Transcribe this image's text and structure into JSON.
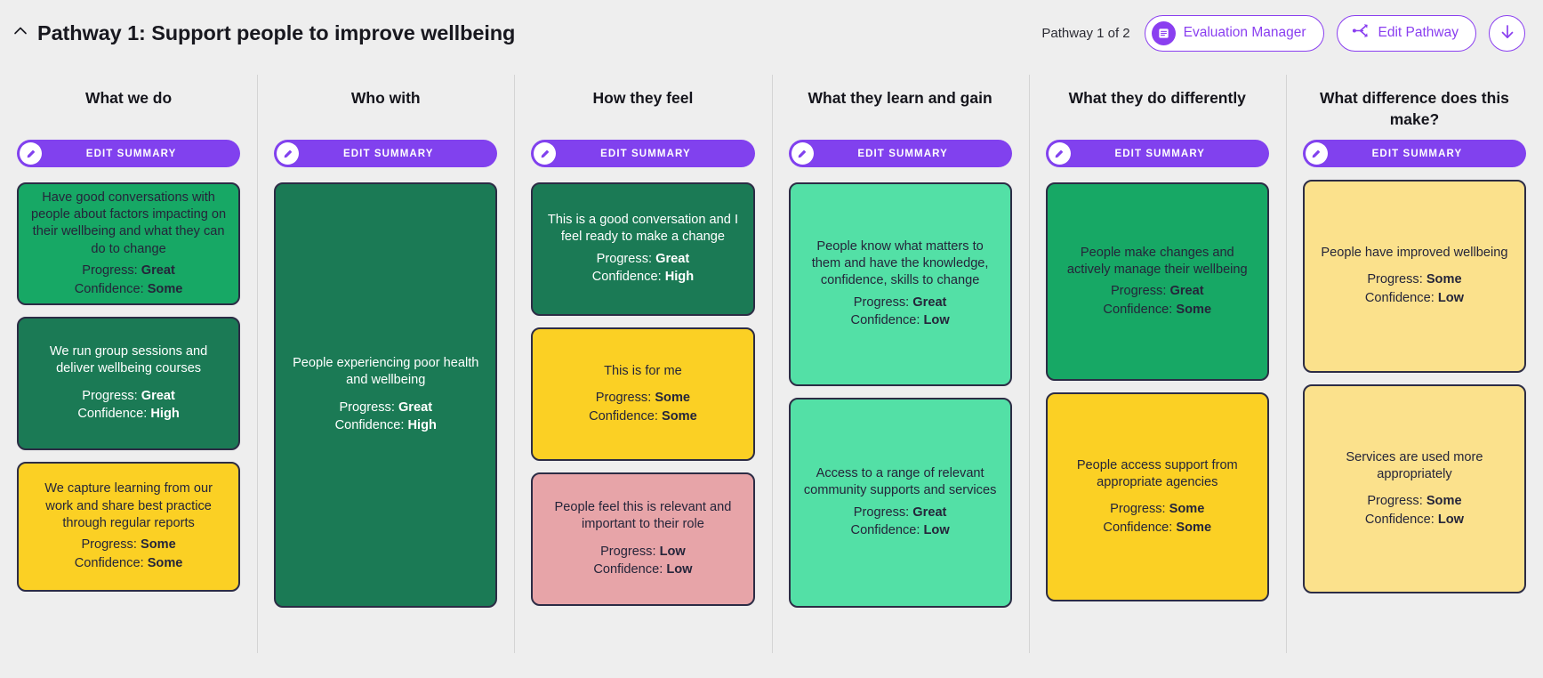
{
  "header": {
    "collapse_icon": "chevron-up-icon",
    "title": "Pathway 1: Support people to improve wellbeing",
    "pathway_count": "Pathway 1 of 2",
    "evaluation_manager_label": "Evaluation Manager",
    "evaluation_manager_icon": "list-document-icon",
    "edit_pathway_label": "Edit Pathway",
    "edit_pathway_icon": "share-network-icon",
    "download_icon": "download-arrow-icon",
    "accent_color": "#8a3ff0"
  },
  "edit_summary_label": "EDIT SUMMARY",
  "edit_summary_icon": "pencil-icon",
  "labels": {
    "progress": "Progress:",
    "confidence": "Confidence:"
  },
  "columns": [
    {
      "title": "What we do",
      "cards": [
        {
          "text": "Have good conversations with people about factors impacting on their wellbeing and what they can do to change",
          "progress": "Great",
          "confidence": "Some",
          "color": "#17a865",
          "variant": "c-green-mid"
        },
        {
          "text": "We run group sessions and deliver wellbeing courses",
          "progress": "Great",
          "confidence": "High",
          "color": "#1b7a55",
          "variant": "c-green-dark"
        },
        {
          "text": "We capture learning from our work and share best practice through regular reports",
          "progress": "Some",
          "confidence": "Some",
          "color": "#fbd024",
          "variant": "c-yellow"
        }
      ]
    },
    {
      "title": "Who with",
      "cards": [
        {
          "text": "People experiencing poor health and wellbeing",
          "progress": "Great",
          "confidence": "High",
          "color": "#1b7a55",
          "variant": "c-green-dark"
        }
      ]
    },
    {
      "title": "How they feel",
      "cards": [
        {
          "text": "This is a good conversation and I feel ready to make a change",
          "progress": "Great",
          "confidence": "High",
          "color": "#1b7a55",
          "variant": "c-green-dark"
        },
        {
          "text": "This is for me",
          "progress": "Some",
          "confidence": "Some",
          "color": "#fbd024",
          "variant": "c-yellow"
        },
        {
          "text": "People feel this is relevant and important to their role",
          "progress": "Low",
          "confidence": "Low",
          "color": "#e7a4a8",
          "variant": "c-pink"
        }
      ]
    },
    {
      "title": "What they learn and gain",
      "cards": [
        {
          "text": "People know what matters to them and have the knowledge, confidence, skills to change",
          "progress": "Great",
          "confidence": "Low",
          "color": "#53e0a6",
          "variant": "c-green-lite"
        },
        {
          "text": "Access to a range of relevant community supports and services",
          "progress": "Great",
          "confidence": "Low",
          "color": "#53e0a6",
          "variant": "c-green-lite"
        }
      ]
    },
    {
      "title": "What they do differently",
      "cards": [
        {
          "text": "People make changes and actively manage their wellbeing",
          "progress": "Great",
          "confidence": "Some",
          "color": "#17a865",
          "variant": "c-green-mid"
        },
        {
          "text": "People access support from appropriate agencies",
          "progress": "Some",
          "confidence": "Some",
          "color": "#fbd024",
          "variant": "c-yellow"
        }
      ]
    },
    {
      "title": "What difference does this make?",
      "cards": [
        {
          "text": "People have improved wellbeing",
          "progress": "Some",
          "confidence": "Low",
          "color": "#fbe18c",
          "variant": "c-yellow-lite"
        },
        {
          "text": "Services are used more appropriately",
          "progress": "Some",
          "confidence": "Low",
          "color": "#fbe18c",
          "variant": "c-yellow-lite"
        }
      ]
    }
  ]
}
